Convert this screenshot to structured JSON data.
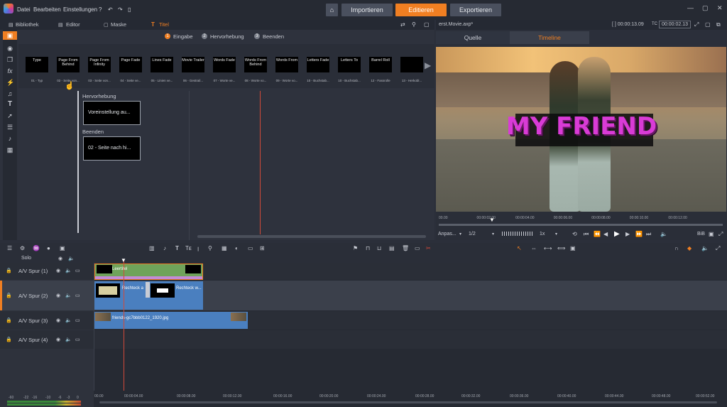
{
  "menu": [
    "Datei",
    "Bearbeiten",
    "Einstellungen"
  ],
  "nav": {
    "import": "Importieren",
    "edit": "Editieren",
    "export": "Exportieren"
  },
  "lefttabs": {
    "library": "Bibliothek",
    "editor": "Editor",
    "mask": "Maske",
    "title": "Titel"
  },
  "steps": [
    {
      "num": "1",
      "label": "Eingabe"
    },
    {
      "num": "2",
      "label": "Hervorhebung"
    },
    {
      "num": "3",
      "label": "Beenden"
    }
  ],
  "thumbs": [
    {
      "text": "Type",
      "cap": "01 - Typ"
    },
    {
      "text": "Page From Behind",
      "cap": "02 - Seite von..."
    },
    {
      "text": "Page From Infinity",
      "cap": "03 - Seite von..."
    },
    {
      "text": "Page Fade",
      "cap": "04 - Seite ve..."
    },
    {
      "text": "Lines Fade",
      "cap": "05 - Linien ve..."
    },
    {
      "text": "Movie Trailer",
      "cap": "06 - Gestrail..."
    },
    {
      "text": "Words Fade",
      "cap": "07 - Worte ve..."
    },
    {
      "text": "Words From Behind",
      "cap": "08 - Worte vo..."
    },
    {
      "text": "Words From",
      "cap": "09 - Worte vo..."
    },
    {
      "text": "Letters Fade",
      "cap": "10 - Buchstab..."
    },
    {
      "text": "Letters To",
      "cap": "10 - Buchstab..."
    },
    {
      "text": "Barrel Roll",
      "cap": "12 - Fassrolle"
    },
    {
      "text": "",
      "cap": "13 - Herkobl..."
    }
  ],
  "sections": {
    "highlight": "Hervorhebung",
    "highlight_value": "Voreinstellung au...",
    "end": "Beenden",
    "end_value": "02 - Seite nach hi..."
  },
  "preview": {
    "file": "erst.Movie.axp*",
    "timecode_a": "[ ] 00:00:13.09",
    "tc_label": "TC",
    "timecode_b": "00:00:02.13",
    "tab_source": "Quelle",
    "tab_timeline": "Timeline",
    "title_text": "MY FRIEND",
    "ruler": [
      "00.00",
      "00:00:02.00",
      "00:00:04.00",
      "00:00:06.00",
      "00:00:08.00",
      "00:00:10.00",
      "00:00:12.00"
    ],
    "fit": "Anpas...",
    "ratio": "1/2",
    "speed": "1x",
    "bib": "BiB"
  },
  "timeline": {
    "solo": "Solo",
    "tracks": [
      "A/V Spur (1)",
      "A/V Spur (2)",
      "A/V Spur (3)",
      "A/V Spur (4)"
    ],
    "clips": {
      "title": "Leertitel",
      "rect1": "Rechteck a",
      "rect2": "Rechteck w...",
      "photo": "friends-gc7bbb0122_1920.jpg"
    },
    "ticks": [
      "00.00",
      "00:00:04.00",
      "00:00:08.00",
      "00:00:12.00",
      "00:00:16.00",
      "00:00:20.00",
      "00:00:24.00",
      "00:00:28.00",
      "00:00:32.00",
      "00:00:36.00",
      "00:00:40.00",
      "00:00:44.00",
      "00:00:48.00",
      "00:00:52.00"
    ],
    "meter": [
      "-60",
      "-22",
      "-16",
      "-10",
      "-6",
      "-3",
      "0"
    ]
  },
  "colors": {
    "accent": "#f07f22",
    "clip_green": "#6fa35a",
    "clip_blue": "#4a7fbf",
    "title_pink": "#d93bd6"
  }
}
